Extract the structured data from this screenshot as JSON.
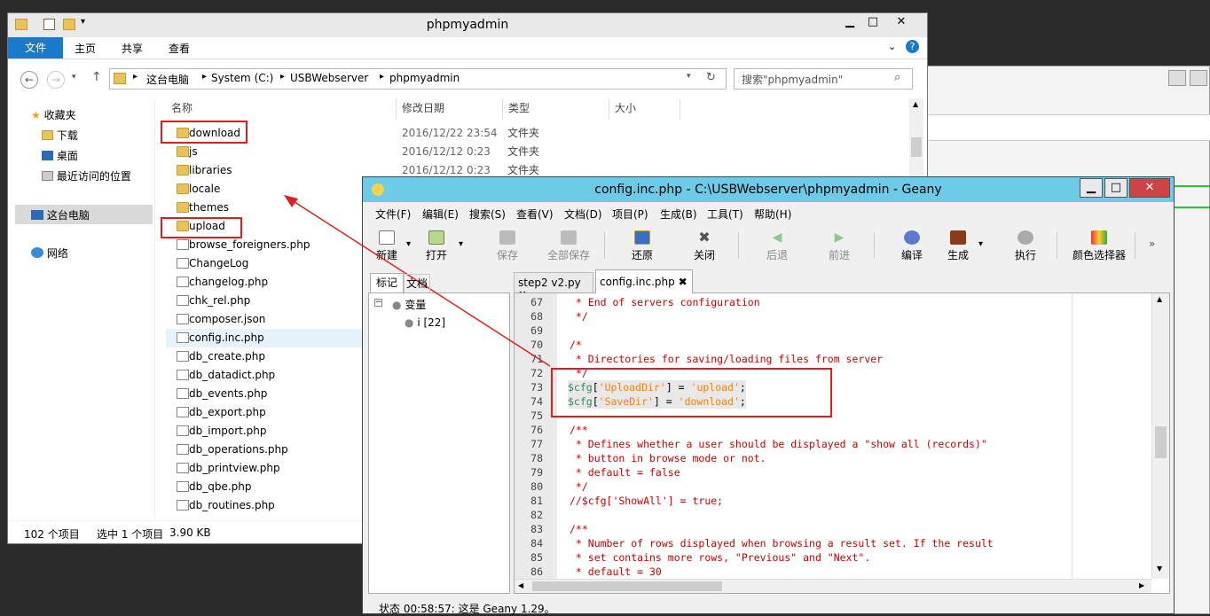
{
  "explorer": {
    "title": "phpmyadmin",
    "ribbon": [
      "文件",
      "主页",
      "共享",
      "查看"
    ],
    "breadcrumb": [
      "这台电脑",
      "System (C:)",
      "USBWebserver",
      "phpmyadmin"
    ],
    "search_placeholder": "搜索\"phpmyadmin\"",
    "nav": {
      "favorites": "收藏夹",
      "downloads": "下载",
      "desktop": "桌面",
      "recent": "最近访问的位置",
      "this_pc": "这台电脑",
      "network": "网络"
    },
    "columns": [
      "名称",
      "修改日期",
      "类型",
      "大小"
    ],
    "files": [
      {
        "name": "download",
        "date": "2016/12/22 23:54",
        "type": "文件夹",
        "kind": "folder"
      },
      {
        "name": "js",
        "date": "2016/12/12 0:23",
        "type": "文件夹",
        "kind": "folder"
      },
      {
        "name": "libraries",
        "date": "2016/12/12 0:23",
        "type": "文件夹",
        "kind": "folder"
      },
      {
        "name": "locale",
        "date": "",
        "type": "",
        "kind": "folder"
      },
      {
        "name": "themes",
        "date": "",
        "type": "",
        "kind": "folder"
      },
      {
        "name": "upload",
        "date": "",
        "type": "",
        "kind": "folder"
      },
      {
        "name": "browse_foreigners.php",
        "date": "",
        "type": "",
        "kind": "file"
      },
      {
        "name": "ChangeLog",
        "date": "",
        "type": "",
        "kind": "file"
      },
      {
        "name": "changelog.php",
        "date": "",
        "type": "",
        "kind": "file"
      },
      {
        "name": "chk_rel.php",
        "date": "",
        "type": "",
        "kind": "file"
      },
      {
        "name": "composer.json",
        "date": "",
        "type": "",
        "kind": "file"
      },
      {
        "name": "config.inc.php",
        "date": "",
        "type": "",
        "kind": "file"
      },
      {
        "name": "db_create.php",
        "date": "",
        "type": "",
        "kind": "file"
      },
      {
        "name": "db_datadict.php",
        "date": "",
        "type": "",
        "kind": "file"
      },
      {
        "name": "db_events.php",
        "date": "",
        "type": "",
        "kind": "file"
      },
      {
        "name": "db_export.php",
        "date": "",
        "type": "",
        "kind": "file"
      },
      {
        "name": "db_import.php",
        "date": "",
        "type": "",
        "kind": "file"
      },
      {
        "name": "db_operations.php",
        "date": "",
        "type": "",
        "kind": "file"
      },
      {
        "name": "db_printview.php",
        "date": "",
        "type": "",
        "kind": "file"
      },
      {
        "name": "db_qbe.php",
        "date": "",
        "type": "",
        "kind": "file"
      },
      {
        "name": "db_routines.php",
        "date": "",
        "type": "",
        "kind": "file"
      }
    ],
    "status": {
      "count": "102 个项目",
      "selected": "选中 1 个项目",
      "size": "3.90 KB"
    }
  },
  "geany": {
    "title": "config.inc.php - C:\\USBWebserver\\phpmyadmin - Geany",
    "menu": [
      "文件(F)",
      "编辑(E)",
      "搜索(S)",
      "查看(V)",
      "文档(D)",
      "项目(P)",
      "生成(B)",
      "工具(T)",
      "帮助(H)"
    ],
    "toolbar": {
      "new": "新建",
      "open": "打开",
      "save": "保存",
      "save_all": "全部保存",
      "revert": "还原",
      "close": "关闭",
      "back": "后退",
      "forward": "前进",
      "compile": "编译",
      "build": "生成",
      "run": "执行",
      "color": "颜色选择器",
      "more": "»"
    },
    "side_tabs": [
      "标记",
      "文档"
    ],
    "symbols": {
      "group": "变量",
      "item": "i [22]"
    },
    "doc_tabs": [
      "step2 v2.py",
      "config.inc.php"
    ],
    "code": [
      {
        "n": "67",
        "t": " * End of servers configuration",
        "c": "cmt"
      },
      {
        "n": "68",
        "t": " */",
        "c": "cmt"
      },
      {
        "n": "69",
        "t": "",
        "c": ""
      },
      {
        "n": "70",
        "t": "/*",
        "c": "cmt"
      },
      {
        "n": "71",
        "t": " * Directories for saving/loading files from server",
        "c": "cmt"
      },
      {
        "n": "72",
        "t": " */",
        "c": "cmt"
      },
      {
        "n": "73",
        "t": "$cfg['UploadDir'] = 'upload';",
        "c": "code"
      },
      {
        "n": "74",
        "t": "$cfg['SaveDir'] = 'download';",
        "c": "code"
      },
      {
        "n": "75",
        "t": "",
        "c": ""
      },
      {
        "n": "76",
        "t": "/**",
        "c": "cmt"
      },
      {
        "n": "77",
        "t": " * Defines whether a user should be displayed a \"show all (records)\"",
        "c": "cmt"
      },
      {
        "n": "78",
        "t": " * button in browse mode or not.",
        "c": "cmt"
      },
      {
        "n": "79",
        "t": " * default = false",
        "c": "cmt"
      },
      {
        "n": "80",
        "t": " */",
        "c": "cmt"
      },
      {
        "n": "81",
        "t": "//$cfg['ShowAll'] = true;",
        "c": "cmt"
      },
      {
        "n": "82",
        "t": "",
        "c": ""
      },
      {
        "n": "83",
        "t": "/**",
        "c": "cmt"
      },
      {
        "n": "84",
        "t": " * Number of rows displayed when browsing a result set. If the result",
        "c": "cmt"
      },
      {
        "n": "85",
        "t": " * set contains more rows, \"Previous\" and \"Next\".",
        "c": "cmt"
      },
      {
        "n": "86",
        "t": " * default = 30",
        "c": "cmt"
      }
    ],
    "status": "状态   00:58:57: 这是 Geany 1.29。"
  },
  "colors": {
    "geany_title": "#6dcbe8",
    "annotation": "#e02020",
    "comment": "#cc0000"
  }
}
